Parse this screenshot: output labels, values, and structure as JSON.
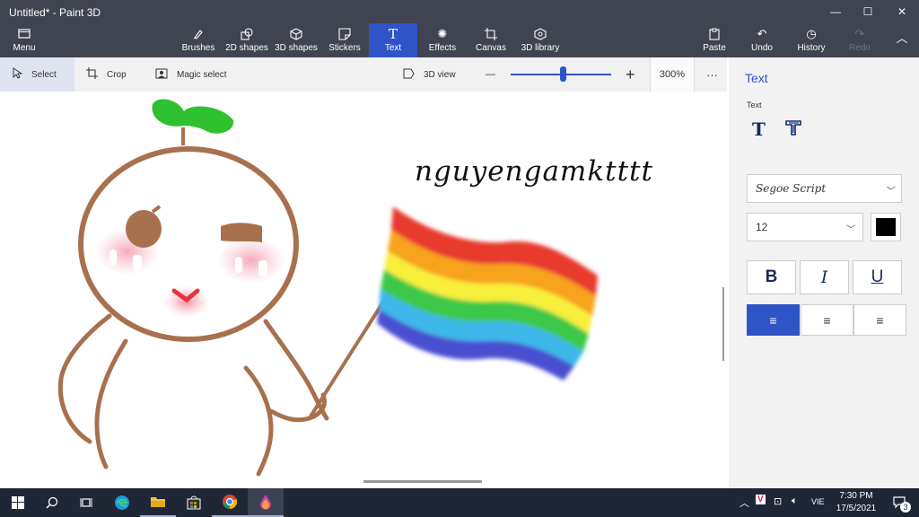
{
  "window": {
    "title": "Untitled* - Paint 3D",
    "controls": {
      "minimize": "—",
      "maximize": "☐",
      "close": "✕"
    }
  },
  "ribbon": {
    "menu": {
      "icon": "menu-folder-icon",
      "label": "Menu"
    },
    "tools": [
      {
        "key": "brushes",
        "icon": "brush-icon",
        "label": "Brushes"
      },
      {
        "key": "2d-shapes",
        "icon": "2d-shapes-icon",
        "label": "2D shapes"
      },
      {
        "key": "3d-shapes",
        "icon": "3d-shapes-icon",
        "label": "3D shapes"
      },
      {
        "key": "stickers",
        "icon": "sticker-icon",
        "label": "Stickers"
      },
      {
        "key": "text",
        "icon": "text-icon",
        "label": "Text",
        "active": true
      },
      {
        "key": "effects",
        "icon": "effects-icon",
        "label": "Effects"
      },
      {
        "key": "canvas",
        "icon": "canvas-icon",
        "label": "Canvas"
      },
      {
        "key": "3d-library",
        "icon": "3d-library-icon",
        "label": "3D library"
      }
    ],
    "actions": [
      {
        "key": "paste",
        "icon": "paste-icon",
        "label": "Paste"
      },
      {
        "key": "undo",
        "icon": "undo-icon",
        "label": "Undo"
      },
      {
        "key": "history",
        "icon": "history-icon",
        "label": "History"
      },
      {
        "key": "redo",
        "icon": "redo-icon",
        "label": "Redo",
        "disabled": true
      }
    ]
  },
  "toolbar": {
    "select": "Select",
    "crop": "Crop",
    "magic_select": "Magic select",
    "view_3d": "3D view",
    "zoom_out": "—",
    "zoom_in": "+",
    "zoom_level": "300%",
    "zoom_fraction": 0.52,
    "more": "···"
  },
  "canvas": {
    "text_object": "nguyengamktttt",
    "drawing": "doodle of a round sprout character holding a rainbow flag"
  },
  "panel": {
    "title": "Text",
    "section": "Text",
    "font": "Segoe Script",
    "size": "12",
    "color": "#000000",
    "bold": "B",
    "italic": "I",
    "underline": "U",
    "align_left": "≡",
    "align_center": "≡",
    "align_right": "≡"
  },
  "taskbar": {
    "apps": [
      "windows-start-icon",
      "search-icon",
      "task-view-icon",
      "edge-icon",
      "file-explorer-icon",
      "store-icon",
      "chrome-icon",
      "paint-3d-icon"
    ],
    "language": "VIE",
    "time": "7:30 PM",
    "date": "17/5/2021",
    "notifications": "3"
  },
  "colors": {
    "accent": "#2f54c8",
    "chrome": "#3f4450",
    "taskbar": "#1f2736"
  }
}
